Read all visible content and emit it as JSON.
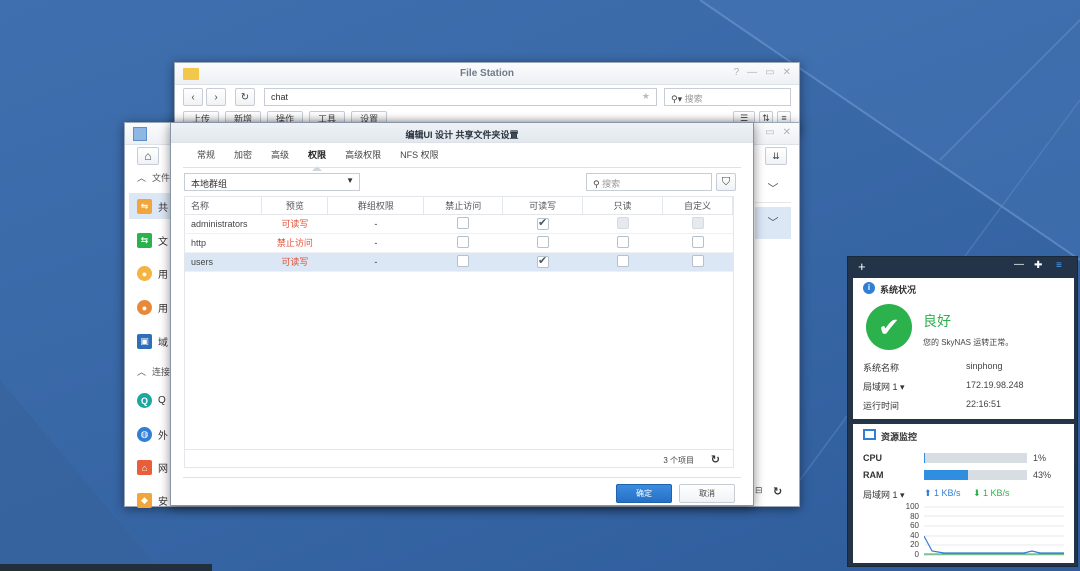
{
  "file_station": {
    "title": "File Station",
    "path": "chat",
    "search_placeholder": "搜索",
    "toolbar": [
      "上传",
      "新增",
      "操作",
      "工具",
      "设置"
    ]
  },
  "control_panel": {
    "sidebar": {
      "section_file": "文件",
      "section_connect": "连接",
      "items": [
        "共",
        "文",
        "用",
        "用",
        "域",
        "Q",
        "外",
        "网",
        "安"
      ]
    }
  },
  "dialog": {
    "title": "编辑UI 设计 共享文件夹设置",
    "tabs": [
      "常规",
      "加密",
      "高级",
      "权限",
      "高级权限",
      "NFS 权限"
    ],
    "active_tab": "权限",
    "group_select": "本地群组",
    "search_placeholder": "搜索",
    "columns": [
      "名称",
      "预览",
      "群组权限",
      "禁止访问",
      "可读写",
      "只读",
      "自定义"
    ],
    "rows": [
      {
        "name": "administrators",
        "preview": "可读写",
        "group": "-",
        "deny": false,
        "rw": true,
        "ro": false,
        "custom": false
      },
      {
        "name": "http",
        "preview": "禁止访问",
        "group": "-",
        "deny": false,
        "rw": false,
        "ro": false,
        "custom": false
      },
      {
        "name": "users",
        "preview": "可读写",
        "group": "-",
        "deny": false,
        "rw": true,
        "ro": false,
        "custom": false
      }
    ],
    "item_count": "3 个项目",
    "ok": "确定",
    "cancel": "取消"
  },
  "widgets": {
    "system_status": {
      "title": "系统状况",
      "status": "良好",
      "message": "您的 SkyNAS 运转正常。",
      "fields": [
        {
          "label": "系统名称",
          "value": "sinphong"
        },
        {
          "label": "局域网 1 ▾",
          "value": "172.19.98.248"
        },
        {
          "label": "运行时间",
          "value": "22:16:51"
        }
      ]
    },
    "resource_monitor": {
      "title": "资源监控",
      "cpu_label": "CPU",
      "cpu_value": "1%",
      "cpu_percent": 1,
      "ram_label": "RAM",
      "ram_value": "43%",
      "ram_percent": 43,
      "lan_label": "局域网 1 ▾",
      "upload": "1 KB/s",
      "download": "1 KB/s",
      "y_ticks": [
        "100",
        "80",
        "60",
        "40",
        "20",
        "0"
      ]
    }
  },
  "colors": {
    "accent": "#2f7fd6",
    "ok_green": "#2bb24c",
    "preview_red": "#e0533a"
  }
}
